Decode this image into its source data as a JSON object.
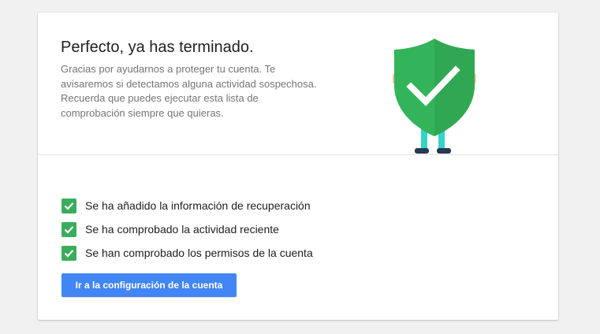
{
  "summary": {
    "title": "Perfecto, ya has terminado.",
    "description": "Gracias por ayudarnos a proteger tu cuenta. Te avisaremos si detectamos alguna actividad sospechosa. Recuerda que puedes ejecutar esta lista de comprobación siempre que quieras.",
    "illustration_icon": "shield-check-icon"
  },
  "checklist": {
    "items": [
      {
        "label": "Se ha añadido la información de recuperación",
        "checked": true
      },
      {
        "label": "Se ha comprobado la actividad reciente",
        "checked": true
      },
      {
        "label": "Se han comprobado los permisos de la cuenta",
        "checked": true
      }
    ]
  },
  "actions": {
    "settings_button_label": "Ir a la configuración de la cuenta"
  },
  "colors": {
    "page_background": "#f1f1f1",
    "card_background": "#ffffff",
    "check_green": "#3aad5b",
    "shield_green": "#34b45a",
    "shield_shade": "#2e9e4f",
    "button_blue": "#4285f4"
  }
}
